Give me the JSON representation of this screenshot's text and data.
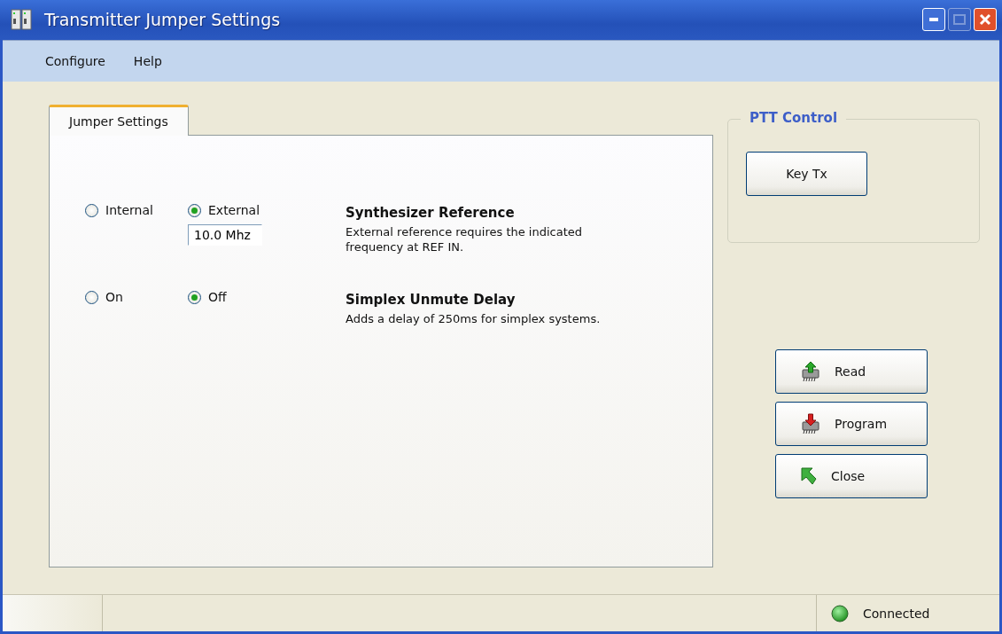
{
  "window": {
    "title": "Transmitter Jumper Settings"
  },
  "menu": [
    {
      "label": "Configure"
    },
    {
      "label": "Help"
    }
  ],
  "tabs": [
    {
      "label": "Jumper Settings",
      "selected": true
    }
  ],
  "settings": [
    {
      "options": [
        {
          "label": "Internal",
          "selected": false
        },
        {
          "label": "External",
          "selected": true
        }
      ],
      "field": {
        "value": "10.0 Mhz"
      },
      "title": "Synthesizer Reference",
      "description": "External reference requires the indicated frequency at REF IN."
    },
    {
      "options": [
        {
          "label": "On",
          "selected": false
        },
        {
          "label": "Off",
          "selected": true
        }
      ],
      "title": "Simplex Unmute Delay",
      "description": "Adds a delay of 250ms for simplex systems."
    }
  ],
  "ptt_control": {
    "title": "PTT Control",
    "button": "Key Tx"
  },
  "actions": [
    {
      "kind": "read",
      "label": "Read"
    },
    {
      "kind": "program",
      "label": "Program"
    },
    {
      "kind": "close",
      "label": "Close"
    }
  ],
  "status_bar": {
    "status": "Connected"
  }
}
